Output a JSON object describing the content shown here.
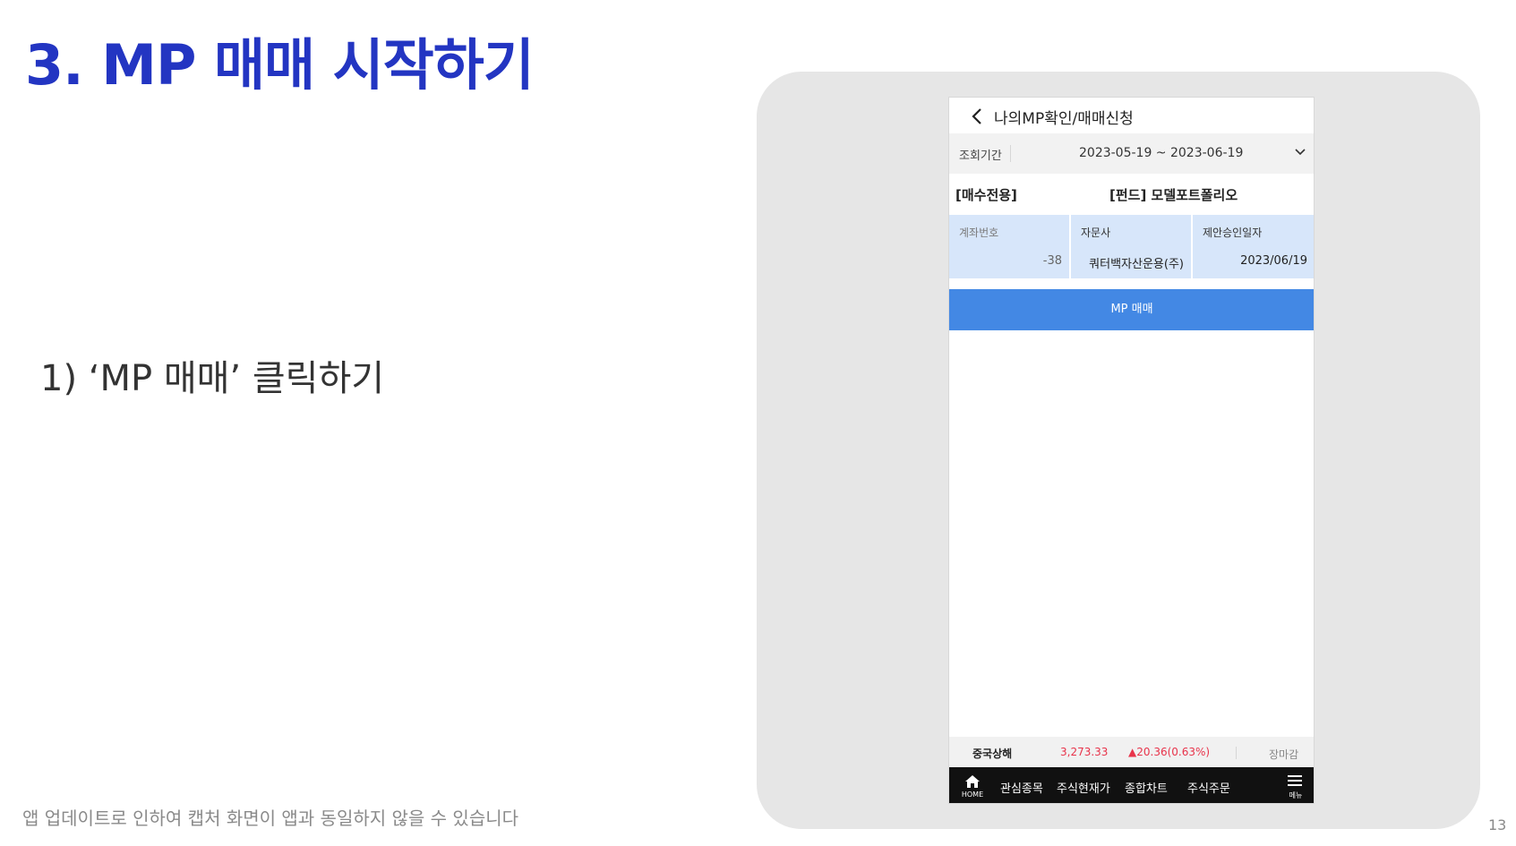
{
  "slide": {
    "title": "3. MP 매매 시작하기",
    "step": "1) ‘MP 매매’ 클릭하기",
    "footnote": "앱 업데이트로 인하여 캡처 화면이 앱과 동일하지 않을 수 있습니다",
    "page_number": "13"
  },
  "app": {
    "header": {
      "title": "나의MP확인/매매신청",
      "back_icon": "chevron-left-icon"
    },
    "period": {
      "label": "조회기간",
      "range": "2023-05-19 ~ 2023-06-19",
      "dropdown_icon": "chevron-down-icon"
    },
    "account": {
      "type": "[매수전용]",
      "name": "[펀드] 모델포트폴리오"
    },
    "info": {
      "account_no_label": "계좌번호",
      "account_no_value": "-38",
      "advisor_label": "자문사",
      "advisor_value": "쿼터백자산운용(주)",
      "approval_label": "제안승인일자",
      "approval_value": "2023/06/19"
    },
    "mp_button": "MP 매매",
    "ticker": {
      "name": "중국상해",
      "value": "3,273.33",
      "change": "▲20.36(0.63%)",
      "status": "장마감"
    },
    "nav": {
      "home": "HOME",
      "items": [
        "관심종목",
        "주식현재가",
        "종합차트",
        "주식주문"
      ],
      "menu": "메뉴"
    }
  },
  "colors": {
    "title": "#2335c2",
    "panel_bg": "#e6e6e6",
    "info_cell_bg": "#d7e6fa",
    "button_bg": "#4388e4",
    "up_red": "#e8344b",
    "nav_bg": "#111111"
  }
}
